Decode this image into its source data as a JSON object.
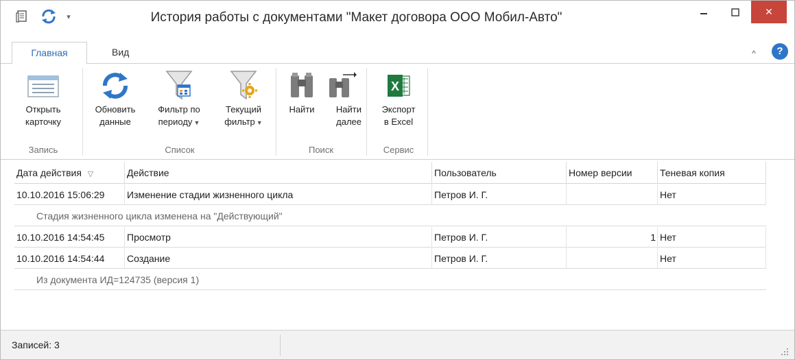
{
  "window": {
    "title": "История работы с документами \"Макет договора ООО Мобил-Авто\"",
    "close_glyph": "✕"
  },
  "tabs": [
    {
      "label": "Главная",
      "active": true
    },
    {
      "label": "Вид",
      "active": false
    }
  ],
  "ribbon": {
    "open_card": {
      "line1": "Открыть",
      "line2": "карточку"
    },
    "refresh": {
      "line1": "Обновить",
      "line2": "данные"
    },
    "period_filter": {
      "line1": "Фильтр по",
      "line2": "периоду"
    },
    "current_filter": {
      "line1": "Текущий",
      "line2": "фильтр"
    },
    "find": {
      "line1": "Найти"
    },
    "find_next": {
      "line1": "Найти",
      "line2": "далее"
    },
    "export": {
      "line1": "Экспорт",
      "line2": "в Excel",
      "icon_letter": "X"
    },
    "groups": {
      "record": "Запись",
      "list": "Список",
      "search": "Поиск",
      "service": "Сервис"
    }
  },
  "grid": {
    "columns": [
      "Дата действия",
      "Действие",
      "Пользователь",
      "Номер версии",
      "Теневая копия"
    ],
    "rows": [
      {
        "date": "10.10.2016 15:06:29",
        "action": "Изменение стадии жизненного цикла",
        "user": "Петров И. Г.",
        "version": "",
        "shadow": "Нет",
        "detail": "Стадия жизненного цикла изменена на \"Действующий\""
      },
      {
        "date": "10.10.2016 14:54:45",
        "action": "Просмотр",
        "user": "Петров И. Г.",
        "version": "1",
        "shadow": "Нет"
      },
      {
        "date": "10.10.2016 14:54:44",
        "action": "Создание",
        "user": "Петров И. Г.",
        "version": "",
        "shadow": "Нет",
        "detail": "Из документа ИД=124735 (версия 1)"
      }
    ]
  },
  "status": {
    "records": "Записей: 3"
  },
  "colors": {
    "accent": "#2b6cb4",
    "close": "#c7453b",
    "refresh_icon": "#2f76c8",
    "excel": "#1f7a3e",
    "filter_gear": "#e8a317"
  }
}
